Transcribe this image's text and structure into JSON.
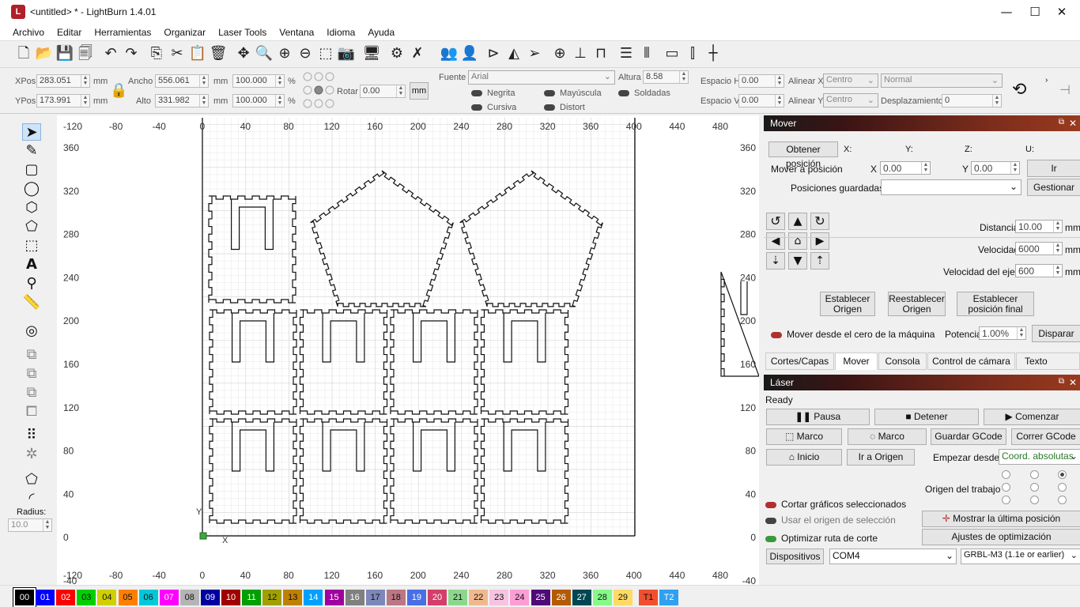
{
  "window": {
    "title": "<untitled> * - LightBurn 1.4.01",
    "app_icon": "lightburn-logo-icon",
    "minimize": "—",
    "maximize": "☐",
    "close": "✕"
  },
  "menu": [
    "Archivo",
    "Editar",
    "Herramientas",
    "Organizar",
    "Laser Tools",
    "Ventana",
    "Idioma",
    "Ayuda"
  ],
  "toolbar_icons": [
    "new-file-icon",
    "open-file-icon",
    "save-icon",
    "save-as-icon",
    "undo-icon",
    "redo-icon",
    "copy-icon",
    "cut-icon",
    "paste-icon",
    "delete-icon",
    "move-icon",
    "zoom-icon",
    "zoom-in-icon",
    "zoom-out-icon",
    "zoom-frame-icon",
    "camera-icon",
    "monitor-icon",
    "settings-icon",
    "tools-icon",
    "group-icon",
    "ungroup-icon",
    "flip-h-icon",
    "mirror-icon",
    "send-icon",
    "target-icon",
    "align-icon",
    "distribute-icon",
    "align-center-icon",
    "distribute-v-icon",
    "ruler-icon",
    "resize-icon",
    "grid-icon"
  ],
  "props": {
    "xpos_label": "XPos",
    "xpos": "283.051",
    "ypos_label": "YPos",
    "ypos": "173.991",
    "unit": "mm",
    "width_label": "Ancho",
    "width": "556.061",
    "height_label": "Alto",
    "height": "331.982",
    "scale_w": "100.000",
    "scale_h": "100.000",
    "pct": "%",
    "rotate_label": "Rotar",
    "rotate": "0.00",
    "mm_button": "mm",
    "font_label": "Fuente",
    "font": "Arial",
    "altura_label": "Altura",
    "altura": "8.58",
    "bold": "Negrita",
    "italic": "Cursiva",
    "upper": "Mayúscula",
    "distort": "Distort",
    "welded": "Soldadas",
    "hspace_label": "Espacio H",
    "hspace": "0.00",
    "vspace_label": "Espacio V",
    "vspace": "0.00",
    "alignx_label": "Alinear X",
    "alignx": "Centro",
    "aligny_label": "Alinear Y",
    "aligny": "Centro",
    "style": "Normal",
    "offset_label": "Desplazamiento",
    "offset": "0"
  },
  "left_tools": [
    "select-icon",
    "pen-icon",
    "rectangle-icon",
    "ellipse-icon",
    "polygon-icon",
    "polyline-icon",
    "frame-icon",
    "text-icon",
    "position-icon",
    "measure-icon",
    "offset-icon",
    "weld-icon",
    "union-icon",
    "subtract-icon",
    "intersect-icon",
    "array-icon",
    "circular-array-icon",
    "node-icon",
    "fillet-icon"
  ],
  "radius_label": "Radius:",
  "radius": "10.0",
  "ruler": {
    "x_ticks": [
      "-120",
      "-80",
      "-40",
      "0",
      "40",
      "80",
      "120",
      "160",
      "200",
      "240",
      "280",
      "320",
      "360",
      "400",
      "440",
      "480"
    ],
    "y_ticks": [
      "360",
      "320",
      "280",
      "240",
      "200",
      "160",
      "120",
      "80",
      "40",
      "0",
      "-40"
    ],
    "right_y_ticks": [
      "360",
      "320",
      "280",
      "240",
      "200",
      "160",
      "120",
      "80",
      "40",
      "0",
      "-40"
    ],
    "axis_x": "X",
    "axis_y": "Y"
  },
  "move_panel": {
    "title": "Mover",
    "get_pos": "Obtener posición",
    "x": "X:",
    "y": "Y:",
    "z": "Z:",
    "u": "U:",
    "move_to": "Mover a posición",
    "xl": "X",
    "xv": "0.00",
    "yl": "Y",
    "yv": "0.00",
    "go": "Ir",
    "saved": "Posiciones guardadas:",
    "manage": "Gestionar",
    "dist_label": "Distancia",
    "dist": "10.00",
    "mm": "mm",
    "speed_label": "Velocidad",
    "speed": "6000",
    "mms": "mm/",
    "zspeed_label": "Velocidad del eje Z",
    "zspeed": "600",
    "set_origin": "Establecer Origen",
    "reset_origin": "Reestablecer Origen",
    "set_final": "Establecer posición final",
    "from_zero": "Mover desde el cero de la máquina",
    "power_label": "Potencia",
    "power": "1.00%",
    "fire": "Disparar"
  },
  "tabs": [
    "Cortes/Capas",
    "Mover",
    "Consola",
    "Control de cámara",
    "Texto variable"
  ],
  "laser_panel": {
    "title": "Láser",
    "status": "Ready",
    "pause": "Pausa",
    "stop": "Detener",
    "start": "Comenzar",
    "frame1": "Marco",
    "frame2": "Marco",
    "save_gcode": "Guardar GCode",
    "run_gcode": "Correr GCode",
    "home": "Inicio",
    "goto_origin": "Ir a Origen",
    "start_from": "Empezar desde:",
    "start_mode": "Coord. absolutas",
    "job_origin": "Origen del trabajo",
    "cut_selected": "Cortar gráficos seleccionados",
    "use_sel_origin": "Usar el origen de selección",
    "show_last": "Mostrar la última posición",
    "optimize": "Optimizar ruta de corte",
    "opt_settings": "Ajustes de optimización",
    "devices": "Dispositivos",
    "port": "COM4",
    "profile": "GRBL-M3 (1.1e or earlier)"
  },
  "palette": [
    {
      "label": "00",
      "color": "#000000",
      "fg": "#ffffff"
    },
    {
      "label": "01",
      "color": "#0000ff",
      "fg": "#ffffff"
    },
    {
      "label": "02",
      "color": "#ff0000",
      "fg": "#ffffff"
    },
    {
      "label": "03",
      "color": "#00d000",
      "fg": "#111111"
    },
    {
      "label": "04",
      "color": "#d0d000",
      "fg": "#111111"
    },
    {
      "label": "05",
      "color": "#ff8000",
      "fg": "#111111"
    },
    {
      "label": "06",
      "color": "#00c8d8",
      "fg": "#111111"
    },
    {
      "label": "07",
      "color": "#ff00ff",
      "fg": "#ffffff"
    },
    {
      "label": "08",
      "color": "#b4b4b4",
      "fg": "#111111"
    },
    {
      "label": "09",
      "color": "#0000a0",
      "fg": "#ffffff"
    },
    {
      "label": "10",
      "color": "#a00000",
      "fg": "#ffffff"
    },
    {
      "label": "11",
      "color": "#00a000",
      "fg": "#ffffff"
    },
    {
      "label": "12",
      "color": "#a0a000",
      "fg": "#111111"
    },
    {
      "label": "13",
      "color": "#c08000",
      "fg": "#111111"
    },
    {
      "label": "14",
      "color": "#00a0ff",
      "fg": "#ffffff"
    },
    {
      "label": "15",
      "color": "#a000a0",
      "fg": "#ffffff"
    },
    {
      "label": "16",
      "color": "#808080",
      "fg": "#ffffff"
    },
    {
      "label": "17",
      "color": "#7d87b9",
      "fg": "#111111"
    },
    {
      "label": "18",
      "color": "#bb7784",
      "fg": "#111111"
    },
    {
      "label": "19",
      "color": "#4a6fe3",
      "fg": "#ffffff"
    },
    {
      "label": "20",
      "color": "#d33f6a",
      "fg": "#ffffff"
    },
    {
      "label": "21",
      "color": "#8cd78c",
      "fg": "#111111"
    },
    {
      "label": "22",
      "color": "#f0b98d",
      "fg": "#111111"
    },
    {
      "label": "23",
      "color": "#f6c4e1",
      "fg": "#111111"
    },
    {
      "label": "24",
      "color": "#fa9ed4",
      "fg": "#111111"
    },
    {
      "label": "25",
      "color": "#500a78",
      "fg": "#ffffff"
    },
    {
      "label": "26",
      "color": "#b45a00",
      "fg": "#ffffff"
    },
    {
      "label": "27",
      "color": "#004754",
      "fg": "#ffffff"
    },
    {
      "label": "28",
      "color": "#86fa88",
      "fg": "#111111"
    },
    {
      "label": "29",
      "color": "#ffdb66",
      "fg": "#111111"
    },
    {
      "label": "T1",
      "color": "#f05030",
      "fg": "#111111"
    },
    {
      "label": "T2",
      "color": "#30a0f0",
      "fg": "#ffffff"
    }
  ]
}
